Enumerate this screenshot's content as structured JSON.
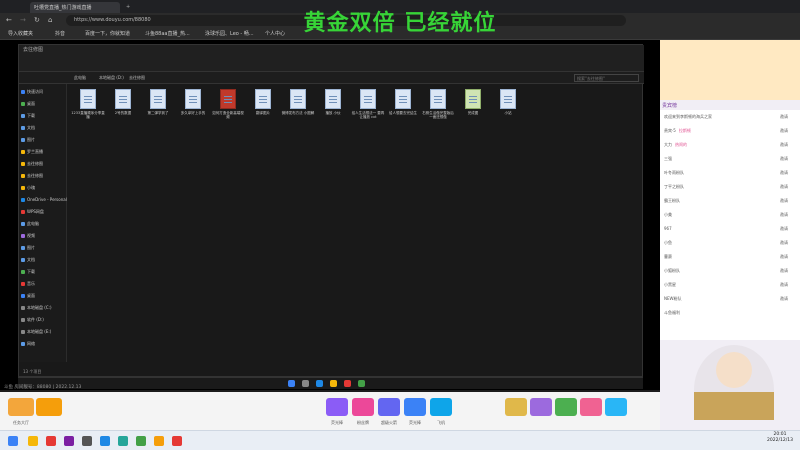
{
  "browser": {
    "tabs": [
      {
        "label": "吐槽党直播_热门游戏直播"
      },
      {
        "label": "+"
      }
    ],
    "url": "https://www.douyu.com/88080",
    "bookmarks": [
      "导入收藏夹",
      "抖音",
      "百度一下，你就知道",
      "斗鱼88aa直播_热...",
      "泳球乐园、Leo - 畅...",
      "个人中心"
    ]
  },
  "overlay": {
    "title": "黄金双倍 已经就位"
  },
  "explorer": {
    "window_title": "去往修图",
    "breadcrumb": [
      "此电脑",
      "本地磁盘 (D:)",
      "去往修图"
    ],
    "search_placeholder": "搜索\"去往修图\"",
    "sidebar": [
      "快速访问",
      "桌面",
      "下载",
      "文档",
      "图片",
      "罗兰直播",
      "去往修图",
      "去往修图",
      "小瑰",
      "OneDrive - Personal",
      "WPS网盘",
      "此电脑",
      "视频",
      "图片",
      "文档",
      "下载",
      "音乐",
      "桌面",
      "本地磁盘 (C:)",
      "软件 (D:)",
      "本地磁盘 (E:)",
      "网络"
    ],
    "files": [
      {
        "name": "1233直播顺序分享直播"
      },
      {
        "name": "2号的数据"
      },
      {
        "name": "第二弹学到了"
      },
      {
        "name": "多久拿好上手的"
      },
      {
        "name": "如何打造全新高端视频"
      },
      {
        "name": "翻译图片"
      },
      {
        "name": "微博发布方法 小图解"
      },
      {
        "name": "播放 小伙"
      },
      {
        "name": "给人生活想法一 要再让播放 cxt"
      },
      {
        "name": "给人想要去完结生"
      },
      {
        "name": "右侧生活做完整版后一面还想做"
      },
      {
        "name": "完成图"
      },
      {
        "name": "小站"
      }
    ],
    "status": "13 个项目"
  },
  "live": {
    "room_info": "斗鱼 房间靓号：88080 | 2022.12.13"
  },
  "gifts": [
    {
      "label": "任务大厅",
      "color": "#f3a63b"
    },
    {
      "label": "荧光棒",
      "color": "#8b5cf6"
    },
    {
      "label": "粉丝牌",
      "color": "#ec4899"
    },
    {
      "label": "超级火箭",
      "color": "#6366f1"
    },
    {
      "label": "荧光棒",
      "color": "#3b82f6"
    },
    {
      "label": "飞机",
      "color": "#0ea5e9"
    }
  ],
  "sidebar": {
    "rank_label": "贵宾榜",
    "chat": [
      {
        "user": "欢迎来到李斯顿的海兵之家",
        "msg": ""
      },
      {
        "user": "贵宾·5",
        "msg": "拉斯顿"
      },
      {
        "user": "大力",
        "msg": "热闹的"
      },
      {
        "user": "三强",
        "msg": ""
      },
      {
        "user": "叶冬雨粉队",
        "msg": ""
      },
      {
        "user": "丁平之粉队",
        "msg": ""
      },
      {
        "user": "霸王粉队",
        "msg": ""
      },
      {
        "user": "小美",
        "msg": ""
      },
      {
        "user": "967",
        "msg": ""
      },
      {
        "user": "小鱼",
        "msg": ""
      },
      {
        "user": "曹赛",
        "msg": ""
      },
      {
        "user": "小狐粉队",
        "msg": ""
      },
      {
        "user": "小黑星",
        "msg": ""
      },
      {
        "user": "NEW粉队",
        "msg": ""
      },
      {
        "user": "斗鱼福利",
        "msg": ""
      }
    ],
    "ranks": [
      "邀请",
      "邀请",
      "邀请",
      "邀请",
      "邀请",
      "邀请",
      "邀请",
      "邀请",
      "邀请",
      "邀请",
      "邀请",
      "邀请",
      "邀请",
      "邀请"
    ]
  },
  "windows": {
    "time": "20:01",
    "date": "2022/12/13"
  }
}
